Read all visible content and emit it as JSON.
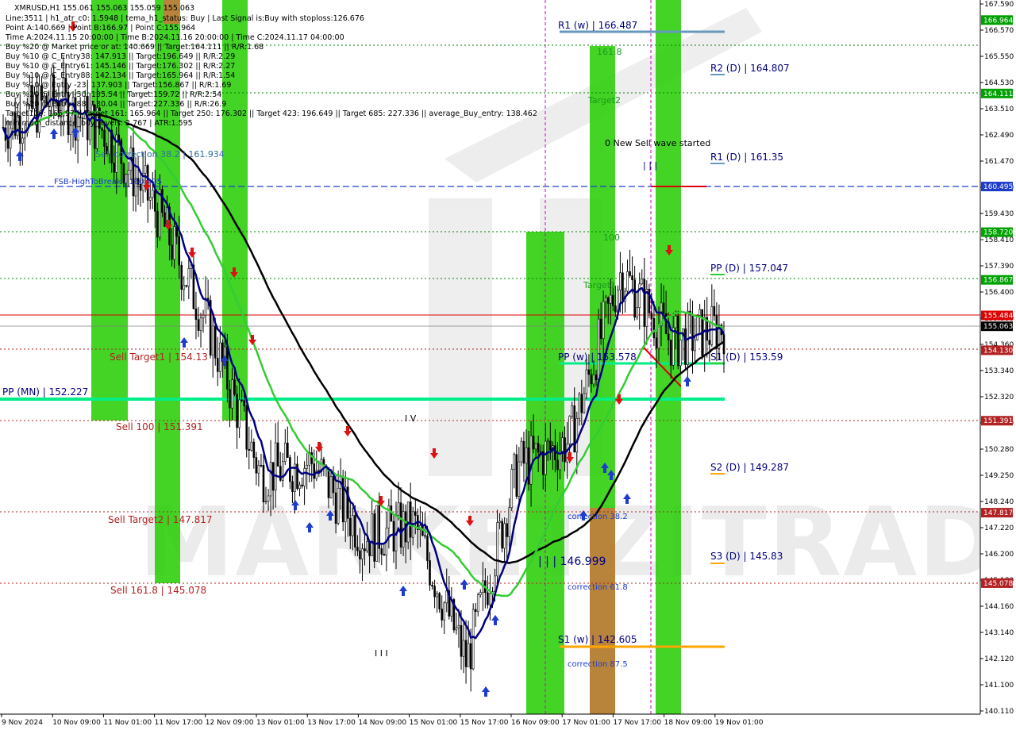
{
  "header": {
    "symbol_line": "XMRUSD,H1  155.061 155.063 155.059 155.063",
    "lines": [
      "Line:3511 | h1_atr_c0: 1.5948 | tema_h1_status: Buy | Last Signal is:Buy with stoploss:126.676",
      "Point A:140.669 | Point B:166.97 | Point C:155.964",
      "Time A:2024.11.15 20:00:00 | Time B:2024.11.16 20:00:00 | Time C:2024.11.17 04:00:00",
      "Buy %20 @ Market price or at: 140.669 || Target:164.111 || R/R:1.68",
      "Buy %10 @ C_Entry38: 147.913 || Target:196.649 || R/R:2.29",
      "Buy %10 @ C_Entry61: 145.146 || Target:176.302 || R/R:2.27",
      "Buy %10 @ C_Entry88: 142.134 || Target:165.964 || R/R:1.54",
      "Buy %10 @ Entry -23: 137.903 || Target:156.867 || R/R:1.69",
      "Buy %20 @ Entry -50: 135.54 || Target:159.72 || R/R:2.54",
      "Buy %20 @ Entry -88: 130.04 || Target:227.336 || R/R:26.9",
      "Target100: 166.97 || Target 161: 165.964 || Target 250: 176.302 || Target 423: 196.649 || Target 685: 227.336 || average_Buy_entry: 138.462",
      "minimum_distance_buy_levels: 2.767 | ATR:1.595"
    ]
  },
  "watermark": "MARKETZITRADE",
  "levels": {
    "r1_w": "R1 (w) | 166.487",
    "r2_d": "R2 (D) | 164.807",
    "r1_d": "R1 (D) | 161.35",
    "pp_d": "PP (D) | 157.047",
    "pp_w": "PP (w) | 153.578",
    "s1_d": "S1 (D) | 153.59",
    "pp_mn": "PP (MN) | 152.227",
    "s2_d": "S2 (D) | 149.287",
    "s3_d": "S3 (D) | 145.83",
    "s1_w": "S1 (w) | 142.605",
    "sell_target1": "Sell Target1 | 154.13",
    "sell_100": "Sell 100 | 151.391",
    "sell_target2": "Sell Target2 | 147.817",
    "sell_161": "Sell 161.8 | 145.078",
    "fsb": "FSB-HighToBreak | 160.495",
    "sell_corr": "Sell correction 38.2 | 161.934",
    "target_161": "161.8",
    "target2": "Target2",
    "target100": "100",
    "target1": "Target1",
    "new_sell_wave": "0 New Sell wave started",
    "iii_146": "| | | 146.999",
    "corr_382": "correction 38.2",
    "corr_618": "correction 61.8",
    "corr_875": "correction 87.5",
    "wave_iv": "I V",
    "wave_iii": "I I I",
    "wave_iii_top": "| | |"
  },
  "price_axis": {
    "ticks": [
      "167.590",
      "166.570",
      "165.550",
      "164.530",
      "163.510",
      "162.490",
      "161.470",
      "160.450",
      "159.430",
      "158.410",
      "157.390",
      "156.400",
      "155.380",
      "154.360",
      "153.340",
      "152.320",
      "151.300",
      "150.280",
      "149.250",
      "148.240",
      "147.220",
      "146.200",
      "145.180",
      "144.160",
      "143.140",
      "142.120",
      "141.100",
      "140.110"
    ],
    "tags": [
      {
        "label": "166.964",
        "color": "#00a000"
      },
      {
        "label": "164.111",
        "color": "#00a000"
      },
      {
        "label": "160.495",
        "color": "#1e3ccc"
      },
      {
        "label": "158.720",
        "color": "#00a000"
      },
      {
        "label": "156.867",
        "color": "#00a000"
      },
      {
        "label": "155.484",
        "color": "#dd0000"
      },
      {
        "label": "155.063",
        "color": "#000000"
      },
      {
        "label": "154.130",
        "color": "#b22222"
      },
      {
        "label": "151.391",
        "color": "#b22222"
      },
      {
        "label": "147.817",
        "color": "#b22222"
      },
      {
        "label": "145.078",
        "color": "#b22222"
      }
    ]
  },
  "time_axis": [
    "9 Nov 2024",
    "10 Nov 09:00",
    "11 Nov 01:00",
    "11 Nov 17:00",
    "12 Nov 09:00",
    "13 Nov 01:00",
    "13 Nov 17:00",
    "14 Nov 09:00",
    "15 Nov 01:00",
    "15 Nov 17:00",
    "16 Nov 09:00",
    "17 Nov 01:00",
    "17 Nov 17:00",
    "18 Nov 09:00",
    "19 Nov 01:00"
  ],
  "colors": {
    "green_band": "#22cc00",
    "orange_band": "#b8843c",
    "pivot_green": "#00ee88",
    "ma_black": "#000000",
    "ma_navy": "#000080",
    "ma_green": "#33cc33",
    "sell_level": "#b22222",
    "buy_level": "#008000",
    "fsb_blue": "#1e3ccc",
    "candle": "#000000",
    "steelblue": "#6699bb",
    "orange": "#ffa500"
  },
  "chart_data": {
    "type": "candlestick",
    "symbol": "XMRUSD",
    "timeframe": "H1",
    "ohlc_last": {
      "open": 155.061,
      "high": 155.063,
      "low": 155.059,
      "close": 155.063
    },
    "y_range": [
      140.11,
      167.59
    ],
    "x_labels": [
      "9 Nov 2024",
      "10 Nov 09:00",
      "11 Nov 01:00",
      "11 Nov 17:00",
      "12 Nov 09:00",
      "13 Nov 01:00",
      "13 Nov 17:00",
      "14 Nov 09:00",
      "15 Nov 01:00",
      "15 Nov 17:00",
      "16 Nov 09:00",
      "17 Nov 01:00",
      "17 Nov 17:00",
      "18 Nov 09:00",
      "19 Nov 01:00"
    ],
    "close_path": [
      {
        "x": "9 Nov 2024",
        "y": 162.8
      },
      {
        "x": "10 Nov 09:00",
        "y": 163.9
      },
      {
        "x": "11 Nov 01:00",
        "y": 162.6
      },
      {
        "x": "11 Nov 17:00",
        "y": 159.5
      },
      {
        "x": "12 Nov 09:00",
        "y": 155.0
      },
      {
        "x": "13 Nov 01:00",
        "y": 149.3
      },
      {
        "x": "13 Nov 17:00",
        "y": 149.8
      },
      {
        "x": "14 Nov 09:00",
        "y": 146.9
      },
      {
        "x": "15 Nov 01:00",
        "y": 147.3
      },
      {
        "x": "15 Nov 17:00",
        "y": 142.0
      },
      {
        "x": "16 Nov 09:00",
        "y": 149.6
      },
      {
        "x": "17 Nov 01:00",
        "y": 150.6
      },
      {
        "x": "17 Nov 17:00",
        "y": 157.2
      },
      {
        "x": "18 Nov 09:00",
        "y": 154.4
      },
      {
        "x": "19 Nov 01:00",
        "y": 155.063
      }
    ],
    "horizontal_levels": [
      {
        "name": "R1 (w)",
        "value": 166.487
      },
      {
        "name": "R2 (D)",
        "value": 164.807
      },
      {
        "name": "R1 (D)",
        "value": 161.35
      },
      {
        "name": "FSB-HighToBreak",
        "value": 160.495
      },
      {
        "name": "PP (D)",
        "value": 157.047
      },
      {
        "name": "Sell Target1",
        "value": 154.13
      },
      {
        "name": "PP (w)",
        "value": 153.578
      },
      {
        "name": "S1 (D)",
        "value": 153.59
      },
      {
        "name": "PP (MN)",
        "value": 152.227
      },
      {
        "name": "Sell 100",
        "value": 151.391
      },
      {
        "name": "S2 (D)",
        "value": 149.287
      },
      {
        "name": "Sell Target2",
        "value": 147.817
      },
      {
        "name": "S3 (D)",
        "value": 145.83
      },
      {
        "name": "Sell 161.8",
        "value": 145.078
      },
      {
        "name": "S1 (w)",
        "value": 142.605
      }
    ]
  }
}
